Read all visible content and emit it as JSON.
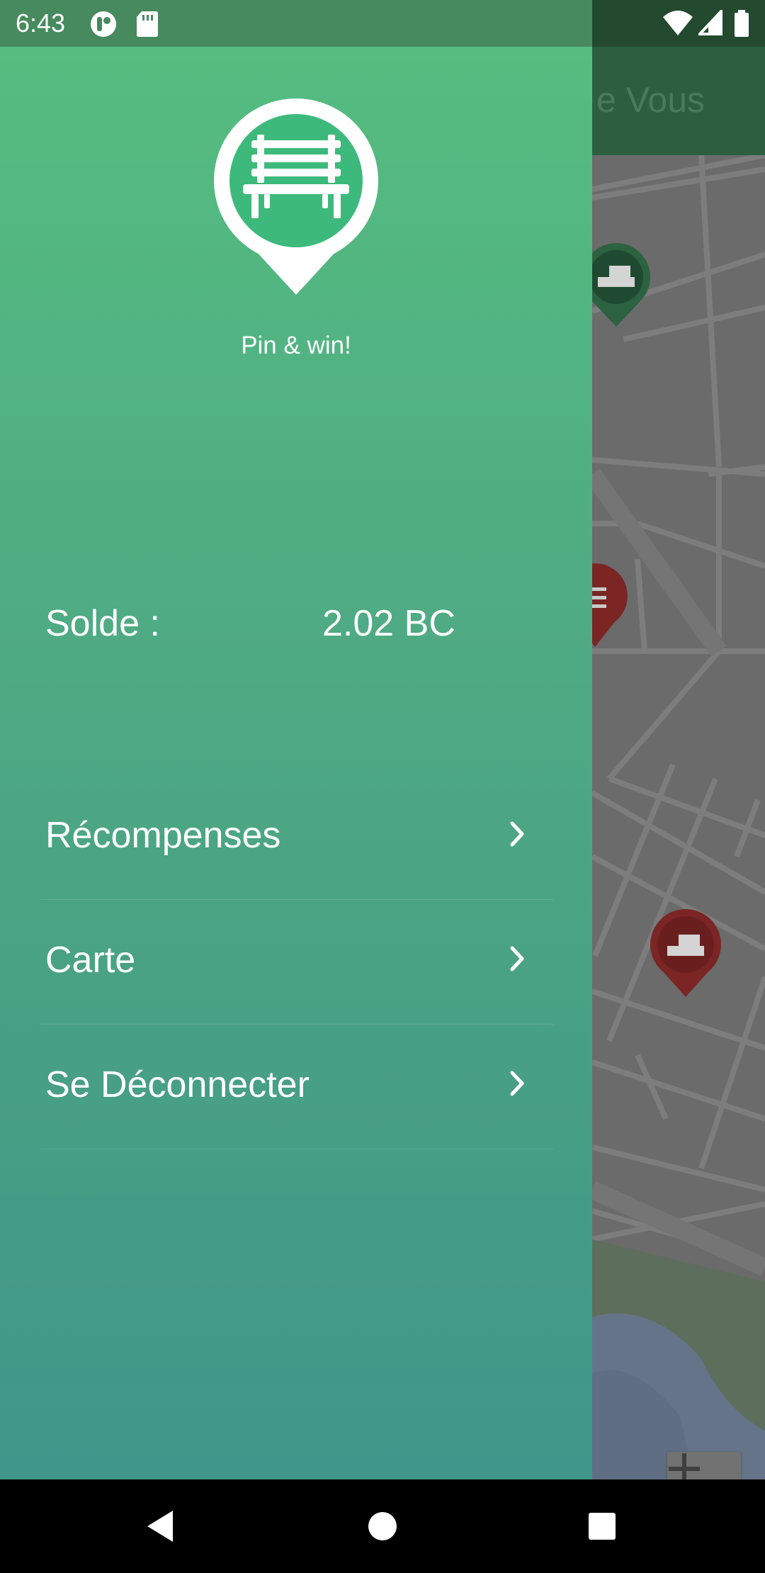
{
  "status_bar": {
    "time": "6:43",
    "left_icons": [
      "app-notification-icon",
      "sd-card-icon"
    ],
    "right_icons": [
      "wifi-icon",
      "cell-signal-icon",
      "battery-icon"
    ]
  },
  "app_bar": {
    "title_visible": "e Vous"
  },
  "drawer": {
    "tagline": "Pin & win!",
    "balance_label": "Solde :",
    "balance_value": "2.02 BC",
    "menu": [
      {
        "label": "Récompenses",
        "icon": "chevron-right-icon"
      },
      {
        "label": "Carte",
        "icon": "chevron-right-icon"
      },
      {
        "label": "Se Déconnecter",
        "icon": "chevron-right-icon"
      }
    ]
  },
  "map": {
    "zoom_in_icon": "plus-icon",
    "zoom_out_icon": "minus-icon"
  },
  "colors": {
    "drawer_top": "#55bd80",
    "drawer_bottom": "#40968a",
    "app_bar": "#2c5e3f",
    "pin_green": "#2d6240",
    "pin_red": "#7b2525"
  }
}
